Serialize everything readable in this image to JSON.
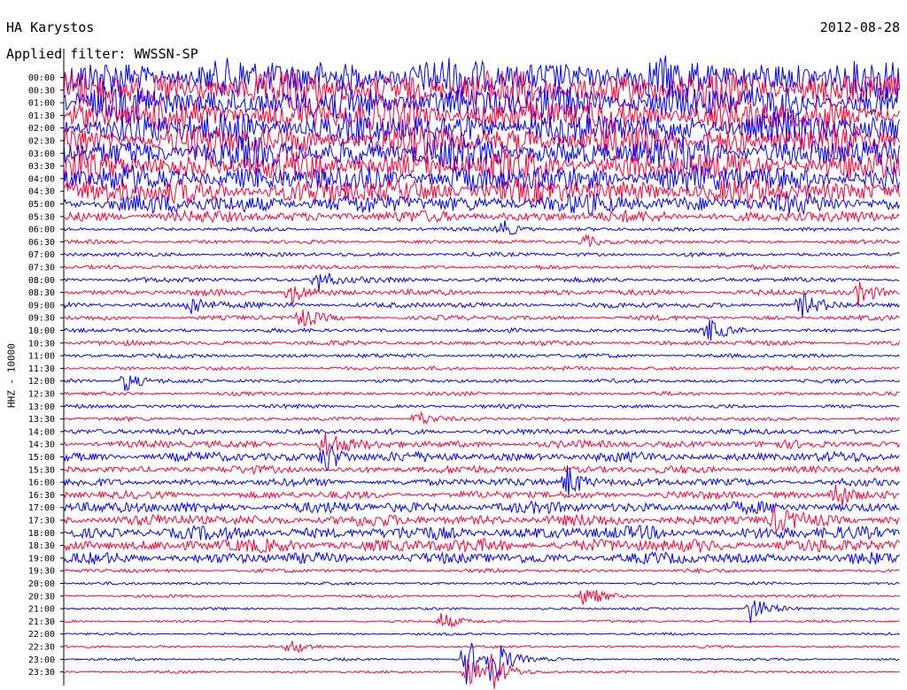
{
  "header": {
    "station": "HA Karystos",
    "date": "2012-08-28",
    "filter": "Applied filter: WWSSN-SP"
  },
  "chart_data": {
    "type": "line",
    "title": "HA Karystos",
    "date": "2012-08-28",
    "subtitle": "Applied filter: WWSSN-SP",
    "ylabel": "HHZ - 10000",
    "row_labels": [
      "00:00",
      "00:30",
      "01:00",
      "01:30",
      "02:00",
      "02:30",
      "03:00",
      "03:30",
      "04:00",
      "04:30",
      "05:00",
      "05:30",
      "06:00",
      "06:30",
      "07:00",
      "07:30",
      "08:00",
      "08:30",
      "09:00",
      "09:30",
      "10:00",
      "10:30",
      "11:00",
      "11:30",
      "12:00",
      "12:30",
      "13:00",
      "13:30",
      "14:00",
      "14:30",
      "15:00",
      "15:30",
      "16:00",
      "16:30",
      "17:00",
      "17:30",
      "18:00",
      "18:30",
      "19:00",
      "19:30",
      "20:00",
      "20:30",
      "21:00",
      "21:30",
      "22:00",
      "22:30",
      "23:00",
      "23:30"
    ],
    "series_colors": [
      "#0000ff",
      "#ff0033"
    ],
    "noise_level": [
      20,
      20,
      18,
      17,
      17,
      16,
      16,
      15,
      14,
      13,
      10,
      6,
      2,
      2,
      2.2,
      2.2,
      2.5,
      3,
      3,
      2.5,
      2.2,
      2.5,
      2.2,
      2,
      2,
      2,
      2,
      2,
      3,
      4,
      5,
      4,
      4,
      4,
      6,
      6,
      7,
      7,
      6,
      2,
      1.5,
      1.5,
      1.3,
      1.3,
      1.3,
      1.3,
      1.3,
      1.3
    ],
    "events": [
      {
        "row": 12,
        "t": 0.52,
        "amp": 14
      },
      {
        "row": 13,
        "t": 0.62,
        "amp": 10
      },
      {
        "row": 16,
        "t": 0.3,
        "amp": 18
      },
      {
        "row": 17,
        "t": 0.27,
        "amp": 16
      },
      {
        "row": 17,
        "t": 0.95,
        "amp": 14
      },
      {
        "row": 18,
        "t": 0.15,
        "amp": 14
      },
      {
        "row": 18,
        "t": 0.88,
        "amp": 15
      },
      {
        "row": 19,
        "t": 0.28,
        "amp": 14
      },
      {
        "row": 20,
        "t": 0.77,
        "amp": 14
      },
      {
        "row": 24,
        "t": 0.07,
        "amp": 16
      },
      {
        "row": 27,
        "t": 0.42,
        "amp": 12
      },
      {
        "row": 29,
        "t": 0.31,
        "amp": 20
      },
      {
        "row": 30,
        "t": 0.31,
        "amp": 22
      },
      {
        "row": 32,
        "t": 0.6,
        "amp": 24
      },
      {
        "row": 33,
        "t": 0.92,
        "amp": 22
      },
      {
        "row": 35,
        "t": 0.85,
        "amp": 12
      },
      {
        "row": 41,
        "t": 0.62,
        "amp": 16
      },
      {
        "row": 42,
        "t": 0.82,
        "amp": 18
      },
      {
        "row": 43,
        "t": 0.45,
        "amp": 12
      },
      {
        "row": 45,
        "t": 0.27,
        "amp": 10
      },
      {
        "row": 46,
        "t": 0.48,
        "amp": 30
      },
      {
        "row": 46,
        "t": 0.51,
        "amp": 32
      },
      {
        "row": 47,
        "t": 0.48,
        "amp": 20
      },
      {
        "row": 47,
        "t": 0.51,
        "amp": 22
      }
    ]
  }
}
